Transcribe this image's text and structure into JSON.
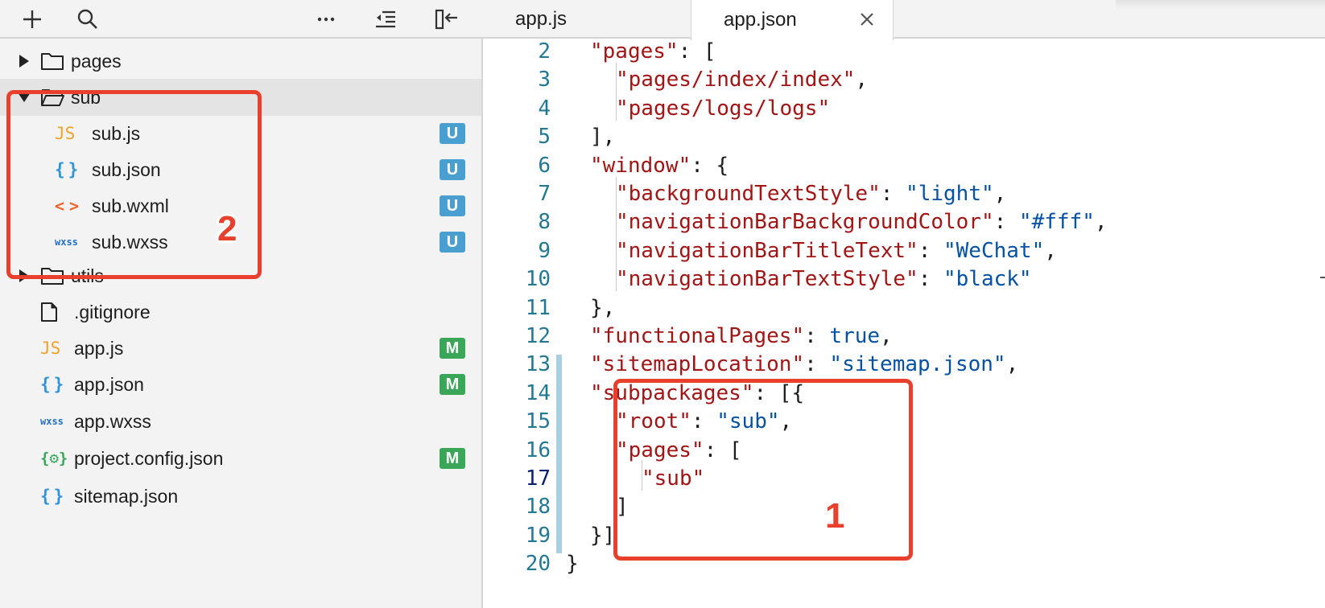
{
  "toolbar": {
    "add_icon": "plus-icon",
    "search_icon": "search-icon",
    "more_icon": "ellipsis-icon",
    "outdent_icon": "outdent-icon",
    "collapse_icon": "collapse-panel-icon"
  },
  "tree": {
    "items": [
      {
        "name": "pages",
        "type": "folder",
        "expanded": false,
        "badge": ""
      },
      {
        "name": "sub",
        "type": "folder",
        "expanded": true,
        "badge": ""
      },
      {
        "name": "sub.js",
        "type": "js",
        "icon_text": "JS",
        "badge": "U"
      },
      {
        "name": "sub.json",
        "type": "json",
        "icon_text": "{}",
        "badge": "U"
      },
      {
        "name": "sub.wxml",
        "type": "wxml",
        "icon_text": "<>",
        "badge": "U"
      },
      {
        "name": "sub.wxss",
        "type": "wxss",
        "icon_text": "wxss",
        "badge": "U"
      },
      {
        "name": "utils",
        "type": "folder",
        "expanded": false,
        "badge": ""
      },
      {
        "name": ".gitignore",
        "type": "file",
        "badge": ""
      },
      {
        "name": "app.js",
        "type": "js",
        "icon_text": "JS",
        "badge": "M"
      },
      {
        "name": "app.json",
        "type": "json",
        "icon_text": "{}",
        "badge": "M"
      },
      {
        "name": "app.wxss",
        "type": "wxss",
        "icon_text": "wxss",
        "badge": ""
      },
      {
        "name": "project.config.json",
        "type": "config",
        "icon_text": "{⚙}",
        "badge": "M"
      },
      {
        "name": "sitemap.json",
        "type": "json",
        "icon_text": "{}",
        "badge": ""
      }
    ]
  },
  "tabs": [
    {
      "label": "app.js",
      "active": false
    },
    {
      "label": "app.json",
      "active": true
    }
  ],
  "editor": {
    "current_line": "17",
    "lines": [
      {
        "n": "2",
        "t": [
          [
            "k",
            "\"pages\""
          ],
          [
            "p",
            ": ["
          ]
        ]
      },
      {
        "n": "3",
        "t": [
          [
            "k",
            "\"pages/index/index\""
          ],
          [
            "p",
            ","
          ]
        ]
      },
      {
        "n": "4",
        "t": [
          [
            "k",
            "\"pages/logs/logs\""
          ]
        ]
      },
      {
        "n": "5",
        "t": [
          [
            "p",
            "],"
          ]
        ]
      },
      {
        "n": "6",
        "t": [
          [
            "k",
            "\"window\""
          ],
          [
            "p",
            ": {"
          ]
        ]
      },
      {
        "n": "7",
        "t": [
          [
            "k",
            "\"backgroundTextStyle\""
          ],
          [
            "p",
            ": "
          ],
          [
            "s",
            "\"light\""
          ],
          [
            "p",
            ","
          ]
        ]
      },
      {
        "n": "8",
        "t": [
          [
            "k",
            "\"navigationBarBackgroundColor\""
          ],
          [
            "p",
            ": "
          ],
          [
            "s",
            "\"#fff\""
          ],
          [
            "p",
            ","
          ]
        ]
      },
      {
        "n": "9",
        "t": [
          [
            "k",
            "\"navigationBarTitleText\""
          ],
          [
            "p",
            ": "
          ],
          [
            "s",
            "\"WeChat\""
          ],
          [
            "p",
            ","
          ]
        ]
      },
      {
        "n": "10",
        "t": [
          [
            "k",
            "\"navigationBarTextStyle\""
          ],
          [
            "p",
            ": "
          ],
          [
            "s",
            "\"black\""
          ]
        ]
      },
      {
        "n": "11",
        "t": [
          [
            "p",
            "},"
          ]
        ]
      },
      {
        "n": "12",
        "t": [
          [
            "k",
            "\"functionalPages\""
          ],
          [
            "p",
            ": "
          ],
          [
            "b",
            "true"
          ],
          [
            "p",
            ","
          ]
        ]
      },
      {
        "n": "13",
        "t": [
          [
            "k",
            "\"sitemapLocation\""
          ],
          [
            "p",
            ": "
          ],
          [
            "s",
            "\"sitemap.json\""
          ],
          [
            "p",
            ","
          ]
        ]
      },
      {
        "n": "14",
        "t": [
          [
            "k",
            "\"subpackages\""
          ],
          [
            "p",
            ": [{"
          ]
        ]
      },
      {
        "n": "15",
        "t": [
          [
            "k",
            "\"root\""
          ],
          [
            "p",
            ": "
          ],
          [
            "s",
            "\"sub\""
          ],
          [
            "p",
            ","
          ]
        ]
      },
      {
        "n": "16",
        "t": [
          [
            "k",
            "\"pages\""
          ],
          [
            "p",
            ": ["
          ]
        ]
      },
      {
        "n": "17",
        "t": [
          [
            "k",
            "\"sub\""
          ]
        ]
      },
      {
        "n": "18",
        "t": [
          [
            "p",
            "]"
          ]
        ]
      },
      {
        "n": "19",
        "t": [
          [
            "p",
            "}]"
          ]
        ]
      },
      {
        "n": "20",
        "t": [
          [
            "p",
            "}"
          ]
        ]
      }
    ]
  },
  "annotations": {
    "label_1": "1",
    "label_2": "2",
    "color": "#e8402c"
  },
  "colors": {
    "json_key": "#a31515",
    "json_string": "#0451a5",
    "line_number": "#237893",
    "badge_untracked": "#4a9fd1",
    "badge_modified": "#3aa658"
  }
}
